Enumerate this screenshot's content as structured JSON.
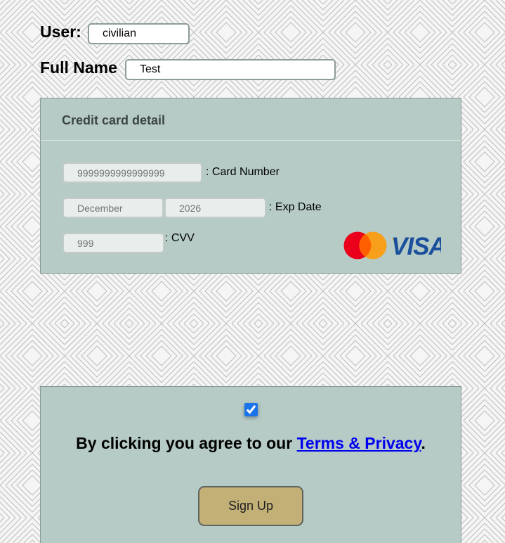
{
  "user": {
    "label": "User:",
    "value": "civilian"
  },
  "full_name": {
    "label": "Full Name",
    "value": "Test"
  },
  "card": {
    "title": "Credit card detail",
    "number_placeholder": "9999999999999999",
    "number_caption": ": Card Number",
    "month_placeholder": "December",
    "year_placeholder": "2026",
    "exp_caption": ": Exp Date",
    "cvv_placeholder": "999",
    "cvv_caption": ": CVV",
    "logos": [
      "mastercard-logo",
      "visa-logo"
    ],
    "visa_text": "VISA"
  },
  "agreement": {
    "checked": true,
    "text_before": "By clicking you agree to our ",
    "link_text": "Terms & Privacy",
    "text_after": "."
  },
  "signup": {
    "label": "Sign Up"
  },
  "colors": {
    "panel": "#b6cbc6",
    "button": "#c2b077",
    "link": "#0000ee",
    "visa_blue": "#1a4f9c",
    "mastercard_red": "#eb001b",
    "mastercard_orange": "#f79e1b"
  }
}
